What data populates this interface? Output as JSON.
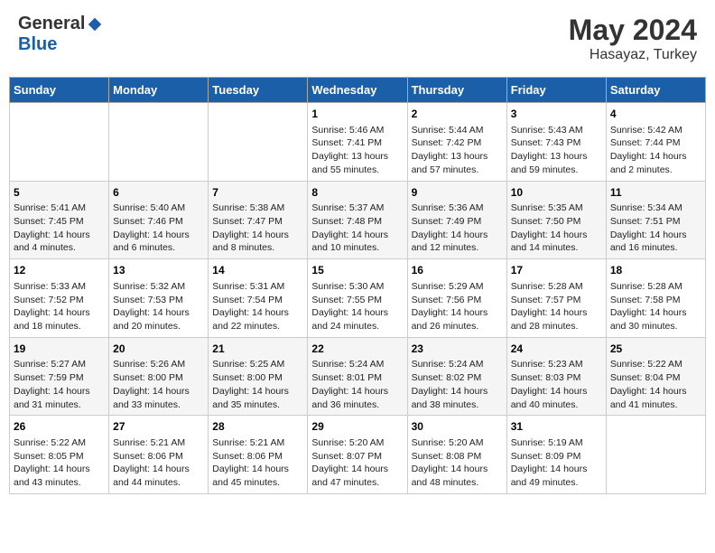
{
  "header": {
    "logo_general": "General",
    "logo_blue": "Blue",
    "month": "May 2024",
    "location": "Hasayaz, Turkey"
  },
  "weekdays": [
    "Sunday",
    "Monday",
    "Tuesday",
    "Wednesday",
    "Thursday",
    "Friday",
    "Saturday"
  ],
  "weeks": [
    [
      {
        "day": "",
        "content": ""
      },
      {
        "day": "",
        "content": ""
      },
      {
        "day": "",
        "content": ""
      },
      {
        "day": "1",
        "content": "Sunrise: 5:46 AM\nSunset: 7:41 PM\nDaylight: 13 hours\nand 55 minutes."
      },
      {
        "day": "2",
        "content": "Sunrise: 5:44 AM\nSunset: 7:42 PM\nDaylight: 13 hours\nand 57 minutes."
      },
      {
        "day": "3",
        "content": "Sunrise: 5:43 AM\nSunset: 7:43 PM\nDaylight: 13 hours\nand 59 minutes."
      },
      {
        "day": "4",
        "content": "Sunrise: 5:42 AM\nSunset: 7:44 PM\nDaylight: 14 hours\nand 2 minutes."
      }
    ],
    [
      {
        "day": "5",
        "content": "Sunrise: 5:41 AM\nSunset: 7:45 PM\nDaylight: 14 hours\nand 4 minutes."
      },
      {
        "day": "6",
        "content": "Sunrise: 5:40 AM\nSunset: 7:46 PM\nDaylight: 14 hours\nand 6 minutes."
      },
      {
        "day": "7",
        "content": "Sunrise: 5:38 AM\nSunset: 7:47 PM\nDaylight: 14 hours\nand 8 minutes."
      },
      {
        "day": "8",
        "content": "Sunrise: 5:37 AM\nSunset: 7:48 PM\nDaylight: 14 hours\nand 10 minutes."
      },
      {
        "day": "9",
        "content": "Sunrise: 5:36 AM\nSunset: 7:49 PM\nDaylight: 14 hours\nand 12 minutes."
      },
      {
        "day": "10",
        "content": "Sunrise: 5:35 AM\nSunset: 7:50 PM\nDaylight: 14 hours\nand 14 minutes."
      },
      {
        "day": "11",
        "content": "Sunrise: 5:34 AM\nSunset: 7:51 PM\nDaylight: 14 hours\nand 16 minutes."
      }
    ],
    [
      {
        "day": "12",
        "content": "Sunrise: 5:33 AM\nSunset: 7:52 PM\nDaylight: 14 hours\nand 18 minutes."
      },
      {
        "day": "13",
        "content": "Sunrise: 5:32 AM\nSunset: 7:53 PM\nDaylight: 14 hours\nand 20 minutes."
      },
      {
        "day": "14",
        "content": "Sunrise: 5:31 AM\nSunset: 7:54 PM\nDaylight: 14 hours\nand 22 minutes."
      },
      {
        "day": "15",
        "content": "Sunrise: 5:30 AM\nSunset: 7:55 PM\nDaylight: 14 hours\nand 24 minutes."
      },
      {
        "day": "16",
        "content": "Sunrise: 5:29 AM\nSunset: 7:56 PM\nDaylight: 14 hours\nand 26 minutes."
      },
      {
        "day": "17",
        "content": "Sunrise: 5:28 AM\nSunset: 7:57 PM\nDaylight: 14 hours\nand 28 minutes."
      },
      {
        "day": "18",
        "content": "Sunrise: 5:28 AM\nSunset: 7:58 PM\nDaylight: 14 hours\nand 30 minutes."
      }
    ],
    [
      {
        "day": "19",
        "content": "Sunrise: 5:27 AM\nSunset: 7:59 PM\nDaylight: 14 hours\nand 31 minutes."
      },
      {
        "day": "20",
        "content": "Sunrise: 5:26 AM\nSunset: 8:00 PM\nDaylight: 14 hours\nand 33 minutes."
      },
      {
        "day": "21",
        "content": "Sunrise: 5:25 AM\nSunset: 8:00 PM\nDaylight: 14 hours\nand 35 minutes."
      },
      {
        "day": "22",
        "content": "Sunrise: 5:24 AM\nSunset: 8:01 PM\nDaylight: 14 hours\nand 36 minutes."
      },
      {
        "day": "23",
        "content": "Sunrise: 5:24 AM\nSunset: 8:02 PM\nDaylight: 14 hours\nand 38 minutes."
      },
      {
        "day": "24",
        "content": "Sunrise: 5:23 AM\nSunset: 8:03 PM\nDaylight: 14 hours\nand 40 minutes."
      },
      {
        "day": "25",
        "content": "Sunrise: 5:22 AM\nSunset: 8:04 PM\nDaylight: 14 hours\nand 41 minutes."
      }
    ],
    [
      {
        "day": "26",
        "content": "Sunrise: 5:22 AM\nSunset: 8:05 PM\nDaylight: 14 hours\nand 43 minutes."
      },
      {
        "day": "27",
        "content": "Sunrise: 5:21 AM\nSunset: 8:06 PM\nDaylight: 14 hours\nand 44 minutes."
      },
      {
        "day": "28",
        "content": "Sunrise: 5:21 AM\nSunset: 8:06 PM\nDaylight: 14 hours\nand 45 minutes."
      },
      {
        "day": "29",
        "content": "Sunrise: 5:20 AM\nSunset: 8:07 PM\nDaylight: 14 hours\nand 47 minutes."
      },
      {
        "day": "30",
        "content": "Sunrise: 5:20 AM\nSunset: 8:08 PM\nDaylight: 14 hours\nand 48 minutes."
      },
      {
        "day": "31",
        "content": "Sunrise: 5:19 AM\nSunset: 8:09 PM\nDaylight: 14 hours\nand 49 minutes."
      },
      {
        "day": "",
        "content": ""
      }
    ]
  ]
}
